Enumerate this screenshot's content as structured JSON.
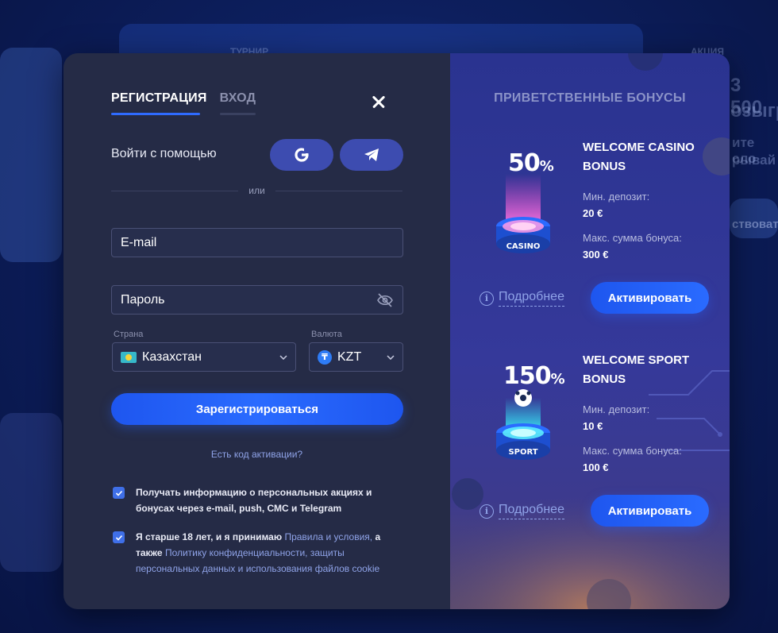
{
  "tabs": {
    "register": "РЕГИСТРАЦИЯ",
    "login": "ВХОД"
  },
  "social": {
    "label": "Войти с помощью",
    "divider": "или"
  },
  "form": {
    "email_placeholder": "E-mail",
    "password_placeholder": "Пароль",
    "country_label": "Страна",
    "country_value": "Казахстан",
    "currency_label": "Валюта",
    "currency_value": "KZT",
    "currency_symbol": "₸",
    "submit": "Зарегистрироваться",
    "activation_link": "Есть код активации?"
  },
  "consents": {
    "promo_text": "Получать информацию о персональных акциях и бонусах через e-mail, push, СМС и Telegram",
    "age_prefix": "Я старше 18 лет, и я принимаю",
    "terms_link": "Правила и условия,",
    "age_mid": "а также",
    "privacy_link": "Политику конфиденциальности, защиты персональных данных и использования файлов cookie"
  },
  "bonuses": {
    "title": "ПРИВЕТСТВЕННЫЕ БОНУСЫ",
    "items": [
      {
        "percent": "50",
        "percent_sign": "%",
        "puck_label": "CASINO",
        "title": "WELCOME CASINO BONUS",
        "min_deposit_label": "Мин. депозит:",
        "min_deposit_value": "20 €",
        "max_bonus_label": "Макс. сумма бонуса:",
        "max_bonus_value": "300 €",
        "more": "Подробнее",
        "activate": "Активировать"
      },
      {
        "percent": "150",
        "percent_sign": "%",
        "puck_label": "SPORT",
        "title": "WELCOME SPORT BONUS",
        "min_deposit_label": "Мин. депозит:",
        "min_deposit_value": "10 €",
        "max_bonus_label": "Макс. сумма бонуса:",
        "max_bonus_value": "100 €",
        "more": "Подробнее",
        "activate": "Активировать"
      }
    ]
  },
  "background": {
    "t1": "ТУРНИР",
    "t2": "3 500",
    "t3": "озыгр",
    "t4": "ите сло",
    "t5": "рывай",
    "t6": "ствоват",
    "t7": "АКЦИЯ"
  },
  "colors": {
    "accent": "#2f6bff",
    "panel": "#252b46",
    "link": "#8fa3e8"
  }
}
